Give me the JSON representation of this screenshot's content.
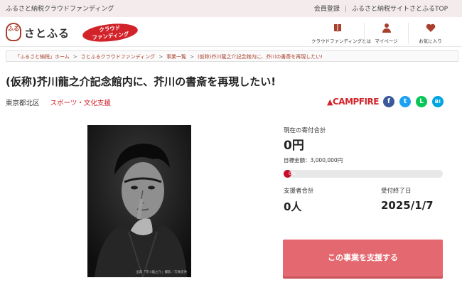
{
  "topbar": {
    "tagline": "ふるさと納税クラウドファンディング",
    "links": [
      "会員登録",
      "ふるさと納税サイトさとふるTOP"
    ],
    "separator": "|"
  },
  "header": {
    "logo_text": "さとふる",
    "logo_seal": "ふる",
    "cf_badge_line1": "クラウド",
    "cf_badge_line2": "ファンディング",
    "nav": [
      {
        "label": "クラウドファンディングとは",
        "icon": "book-icon"
      },
      {
        "label": "マイページ",
        "icon": "user-icon"
      },
      {
        "label": "お気に入り",
        "icon": "heart-icon"
      }
    ]
  },
  "breadcrumb": [
    "「ふるさと納税」ホーム",
    "さとふるクラウドファンディング",
    "事業一覧",
    "(仮称)芥川龍之介記念館内に、芥川の書斎を再現したい!"
  ],
  "project": {
    "title": "(仮称)芥川龍之介記念館内に、芥川の書斎を再現したい!",
    "location": "東京都北区",
    "category": "スポーツ・文化支援",
    "platform": "CAMPFIRE",
    "photo_caption": "出典「芥川龍之介」撮影／写真提供"
  },
  "share": {
    "facebook": "f",
    "twitter": "t",
    "line": "L",
    "hatena": "B!"
  },
  "stats": {
    "current_label": "現在の寄付合計",
    "current_value": "0円",
    "goal_text": "目標金額：3,000,000円",
    "progress_percent": 0,
    "progress_label": "0%",
    "supporters_label": "支援者合計",
    "supporters_value": "0人",
    "deadline_label": "受付終了日",
    "deadline_value": "2025/1/7"
  },
  "cta": {
    "support_button": "この事業を支援する"
  },
  "colors": {
    "brand_red": "#d2232a",
    "seal_brown": "#a9402e",
    "button": "#e4686f"
  }
}
